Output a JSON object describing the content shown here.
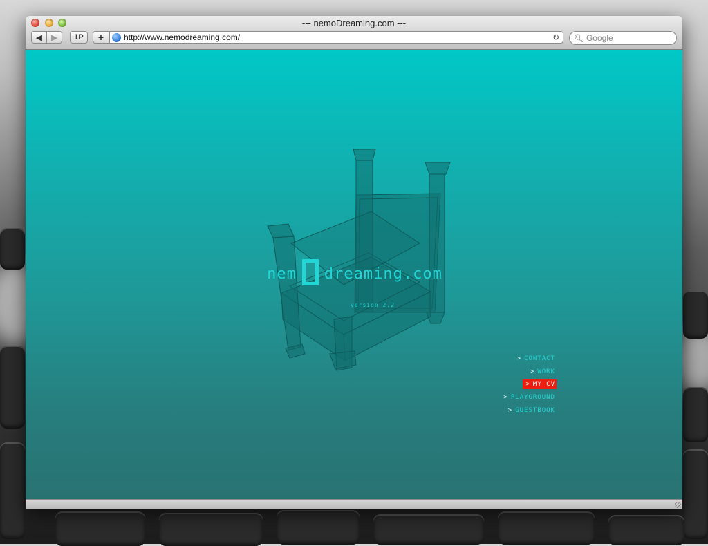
{
  "window": {
    "title": "--- nemoDreaming.com ---"
  },
  "toolbar": {
    "back_label": "◀",
    "forward_label": "▶",
    "onepassword_label": "1P",
    "add_bookmark_label": "+",
    "url": "http://www.nemodreaming.com/",
    "reload_label": "↻",
    "search_placeholder": "Google",
    "search_icon": "search-icon"
  },
  "site": {
    "logo_left": "nem",
    "logo_right": "dreaming.com",
    "version": "version 2.2",
    "menu": [
      {
        "label": "CONTACT",
        "active": false
      },
      {
        "label": "WORK",
        "active": false
      },
      {
        "label": "MY CV",
        "active": true
      },
      {
        "label": "PLAYGROUND",
        "active": false
      },
      {
        "label": "GUESTBOOK",
        "active": false
      }
    ],
    "menu_chevron": ">",
    "colors": {
      "background_top": "#00c8c7",
      "background_bottom": "#297272",
      "text": "#22d6d6",
      "active": "#ea1f12"
    }
  }
}
